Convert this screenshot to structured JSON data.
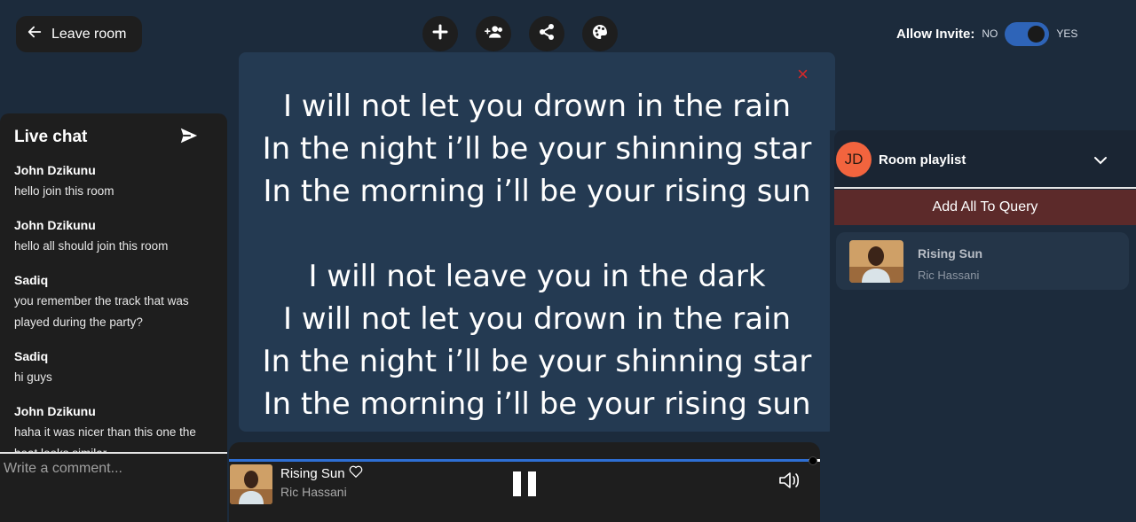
{
  "header": {
    "leave_label": "Leave room",
    "allow_invite_label": "Allow Invite:",
    "toggle_no": "NO",
    "toggle_yes": "YES"
  },
  "actions": {
    "icons": [
      "plus-icon",
      "add-user-icon",
      "share-icon",
      "palette-icon"
    ]
  },
  "chat": {
    "title": "Live chat",
    "messages": [
      {
        "author": "John Dzikunu",
        "text": "hello join this room"
      },
      {
        "author": "John Dzikunu",
        "text": "hello all should join this room"
      },
      {
        "author": "Sadiq",
        "text": "you remember the track that was played during the party?"
      },
      {
        "author": "Sadiq",
        "text": "hi guys"
      },
      {
        "author": "John Dzikunu",
        "text": "haha it was nicer than this one the beat looks similar"
      }
    ],
    "comment_placeholder": "Write a comment..."
  },
  "lyrics": {
    "close_glyph": "×",
    "lines": [
      "I will not let you drown in the rain",
      "In the night i’ll be your shinning star",
      "In the morning i’ll be your rising sun",
      "",
      "I will not leave you in the dark",
      "I will not let you drown in the rain",
      "In the night i’ll be your shinning star",
      "In the morning i’ll be your rising sun"
    ]
  },
  "player": {
    "title": "Rising Sun",
    "artist": "Ric Hassani",
    "progress": 0.98,
    "accent": "#2e6fd4"
  },
  "playlist": {
    "avatar_initials": "JD",
    "title": "Room playlist",
    "add_all_label": "Add All To Query",
    "songs": [
      {
        "title": "Rising Sun",
        "artist": "Ric Hassani"
      }
    ]
  },
  "colors": {
    "background": "#1c2b3c",
    "panel": "#1e1e1e",
    "lyrics_bg": "#243a52",
    "toggle_on": "#2e64b8",
    "add_all_bg": "#5c2a2a",
    "avatar_bg": "#f2643e",
    "close_red": "#d62828"
  }
}
